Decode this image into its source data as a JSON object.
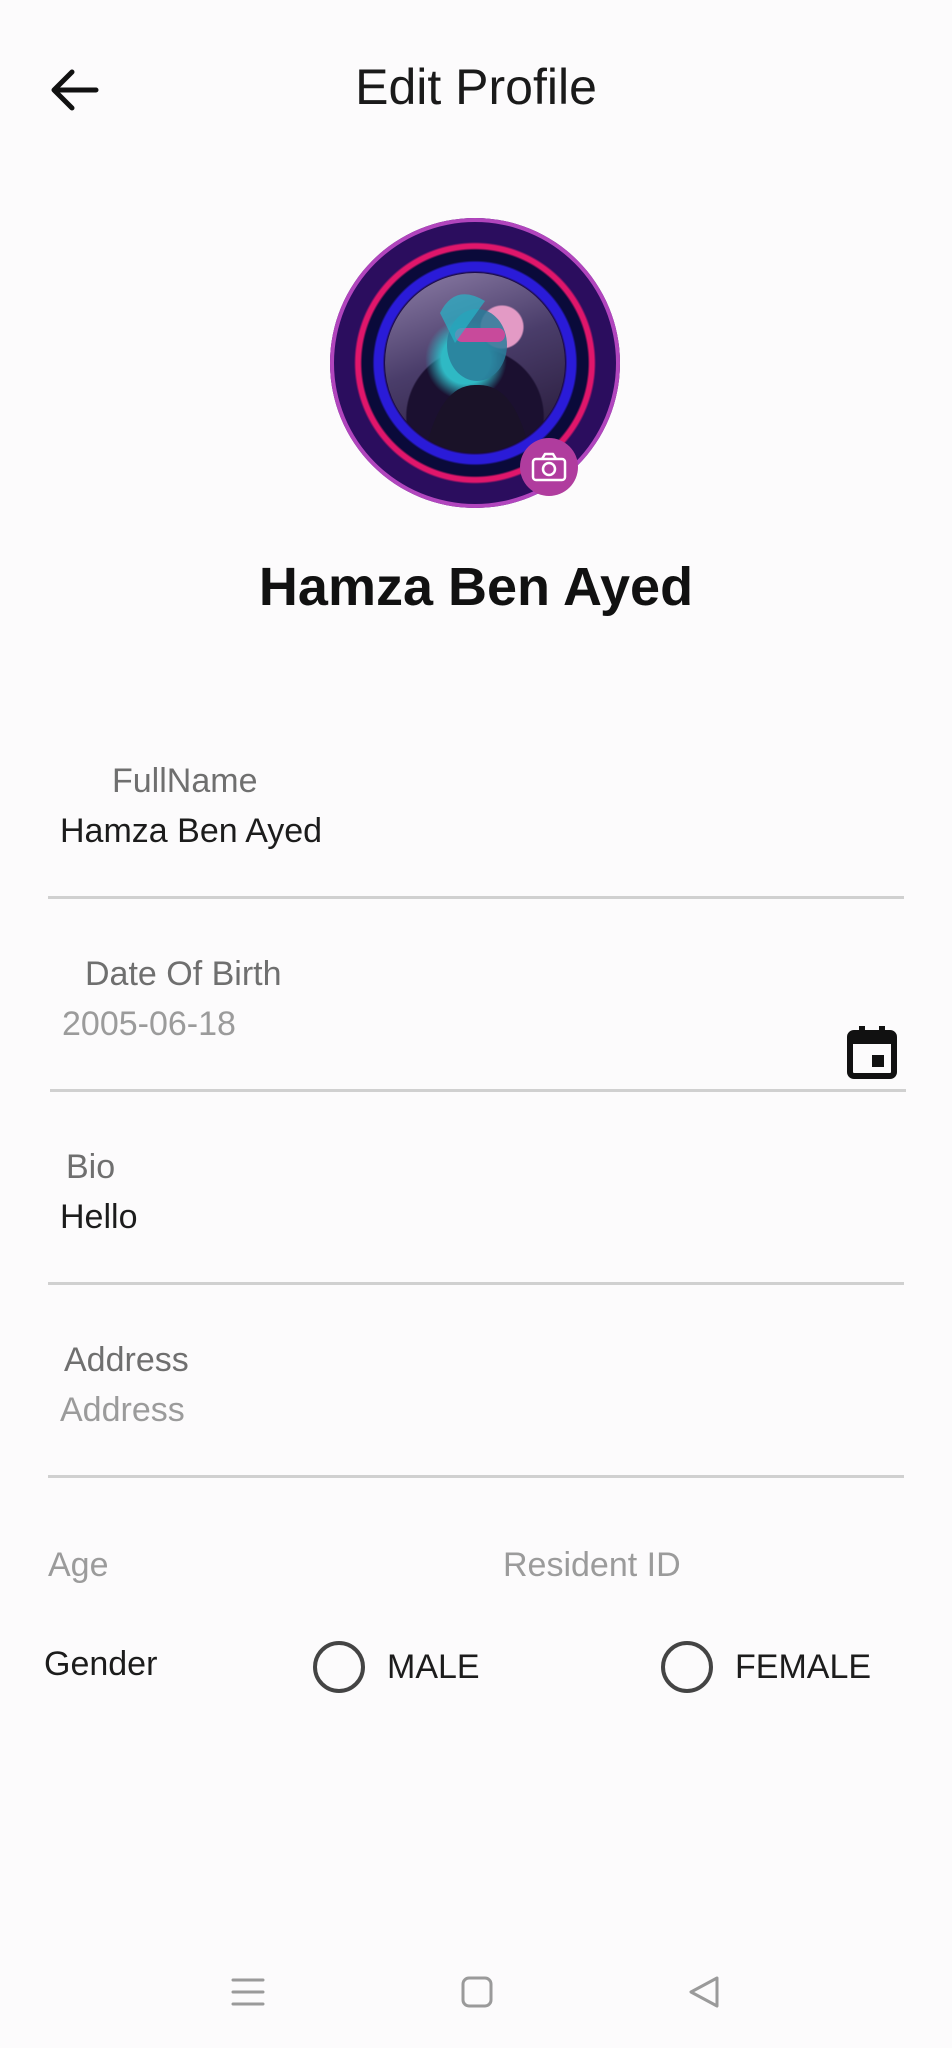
{
  "header": {
    "title": "Edit Profile",
    "back_icon": "arrow-left-icon"
  },
  "profile": {
    "name": "Hamza Ben Ayed",
    "camera_icon": "camera-icon",
    "accent_color": "#b03c9e"
  },
  "fields": {
    "fullname": {
      "label": "FullName",
      "value": "Hamza Ben Ayed"
    },
    "dob": {
      "label": "Date Of Birth",
      "placeholder": "2005-06-18",
      "icon": "calendar-icon"
    },
    "bio": {
      "label": "Bio",
      "value": "Hello"
    },
    "address": {
      "label": "Address",
      "placeholder": "Address"
    },
    "age": {
      "label": "Age"
    },
    "resident_id": {
      "label": "Resident ID"
    }
  },
  "gender": {
    "label": "Gender",
    "options": [
      {
        "label": "MALE",
        "selected": false
      },
      {
        "label": "FEMALE",
        "selected": false
      }
    ]
  },
  "nav_bar": {
    "icons": [
      "menu-icon",
      "home-square-icon",
      "back-triangle-icon"
    ]
  }
}
